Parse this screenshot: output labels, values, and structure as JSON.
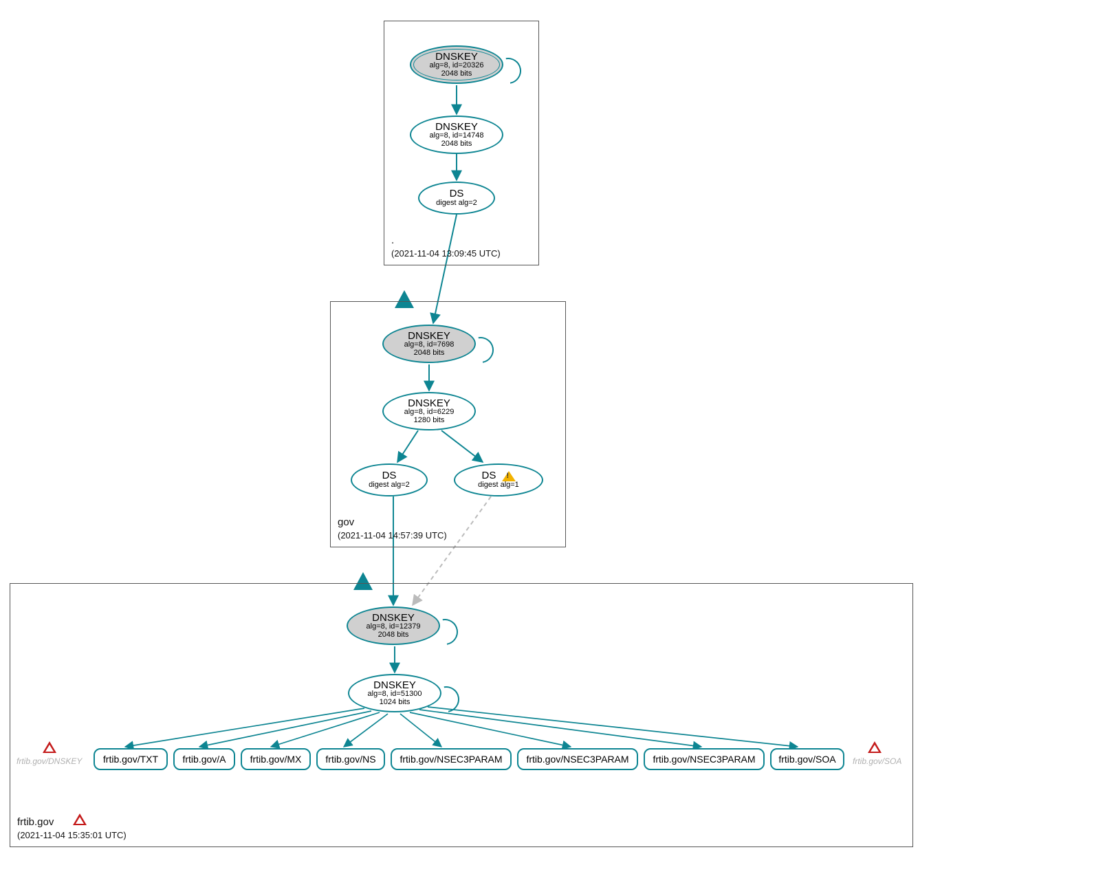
{
  "colors": {
    "stroke": "#0d8592",
    "ksk_fill": "#d0d0d0",
    "box_border": "#555555"
  },
  "zones": {
    "root": {
      "name": ".",
      "timestamp": "(2021-11-04 13:09:45 UTC)"
    },
    "gov": {
      "name": "gov",
      "timestamp": "(2021-11-04 14:57:39 UTC)"
    },
    "frtib": {
      "name": "frtib.gov",
      "timestamp": "(2021-11-04 15:35:01 UTC)"
    }
  },
  "nodes": {
    "root_ksk": {
      "title": "DNSKEY",
      "l1": "alg=8, id=20326",
      "l2": "2048 bits"
    },
    "root_zsk": {
      "title": "DNSKEY",
      "l1": "alg=8, id=14748",
      "l2": "2048 bits"
    },
    "root_ds": {
      "title": "DS",
      "l1": "digest alg=2"
    },
    "gov_ksk": {
      "title": "DNSKEY",
      "l1": "alg=8, id=7698",
      "l2": "2048 bits"
    },
    "gov_zsk": {
      "title": "DNSKEY",
      "l1": "alg=8, id=6229",
      "l2": "1280 bits"
    },
    "gov_ds2": {
      "title": "DS",
      "l1": "digest alg=2"
    },
    "gov_ds1": {
      "title": "DS",
      "l1": "digest alg=1"
    },
    "frtib_ksk": {
      "title": "DNSKEY",
      "l1": "alg=8, id=12379",
      "l2": "2048 bits"
    },
    "frtib_zsk": {
      "title": "DNSKEY",
      "l1": "alg=8, id=51300",
      "l2": "1024 bits"
    }
  },
  "records": {
    "txt": "frtib.gov/TXT",
    "a": "frtib.gov/A",
    "mx": "frtib.gov/MX",
    "ns": "frtib.gov/NS",
    "n3a": "frtib.gov/NSEC3PARAM",
    "n3b": "frtib.gov/NSEC3PARAM",
    "n3c": "frtib.gov/NSEC3PARAM",
    "soa": "frtib.gov/SOA"
  },
  "ghost": {
    "dnskey": "frtib.gov/DNSKEY",
    "soa": "frtib.gov/SOA"
  },
  "ds_warn_label": "DS"
}
